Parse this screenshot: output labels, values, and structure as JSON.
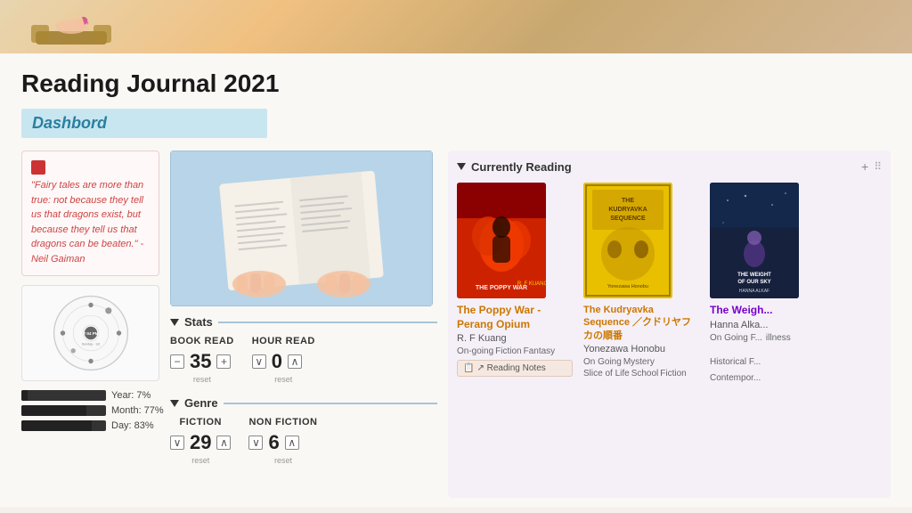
{
  "header": {
    "title": "Reading Journal 2021"
  },
  "dashboard": {
    "tab_label": "Dashbord"
  },
  "quote": {
    "text": "\"Fairy tales are more than true: not because they tell us that dragons exist, but because they tell us that dragons can be beaten.\" - Neil Gaiman"
  },
  "clock": {
    "time": "7:04 PM",
    "day": "Sunday - 1st"
  },
  "progress": {
    "year_label": "Year: 7%",
    "month_label": "Month: 77%",
    "day_label": "Day: 83%",
    "year_pct": 7,
    "month_pct": 77,
    "day_pct": 83
  },
  "stats": {
    "section_title": "Stats",
    "book_read_label": "BOOK READ",
    "book_read_value": "35",
    "hour_read_label": "HOUR READ",
    "hour_read_value": "0",
    "reset_label": "reset",
    "minus_label": "−",
    "plus_label": "+"
  },
  "genre": {
    "section_title": "Genre",
    "fiction_label": "FICTION",
    "fiction_value": "29",
    "nonfiction_label": "NON FICTION",
    "nonfiction_value": "6",
    "reset_label": "reset"
  },
  "currently_reading": {
    "title": "Currently Reading",
    "books": [
      {
        "title": "The Poppy War - Perang Opium",
        "author": "R. F Kuang",
        "tags": [
          "On-going",
          "Fiction",
          "Fantasy"
        ],
        "has_notes": true,
        "notes_label": "Reading Notes",
        "cover_class": "cover-poppy",
        "title_color": "#cc7700"
      },
      {
        "title": "The Kudryavka Sequence ／クドリヤフカの順番",
        "author": "Yonezawa Honobu",
        "tags": [
          "On Going",
          "Mystery",
          "Slice of Life",
          "School",
          "Fiction"
        ],
        "has_notes": false,
        "cover_class": "cover-kudryavka",
        "title_color": "#cc7700"
      },
      {
        "title": "The Weigh...",
        "author": "Hanna Alka...",
        "tags": [
          "On Going F...",
          "illness"
        ],
        "subtitle_tags": [
          "Historical F...",
          "Contempor..."
        ],
        "has_notes": false,
        "cover_class": "cover-weight",
        "title_color": "#7700cc"
      }
    ]
  },
  "icons": {
    "triangle_down": "▼",
    "plus": "+",
    "minus": "−",
    "chevron_down": "∨",
    "chevron_up": "∧",
    "grid_dots": "⋮⋮"
  }
}
